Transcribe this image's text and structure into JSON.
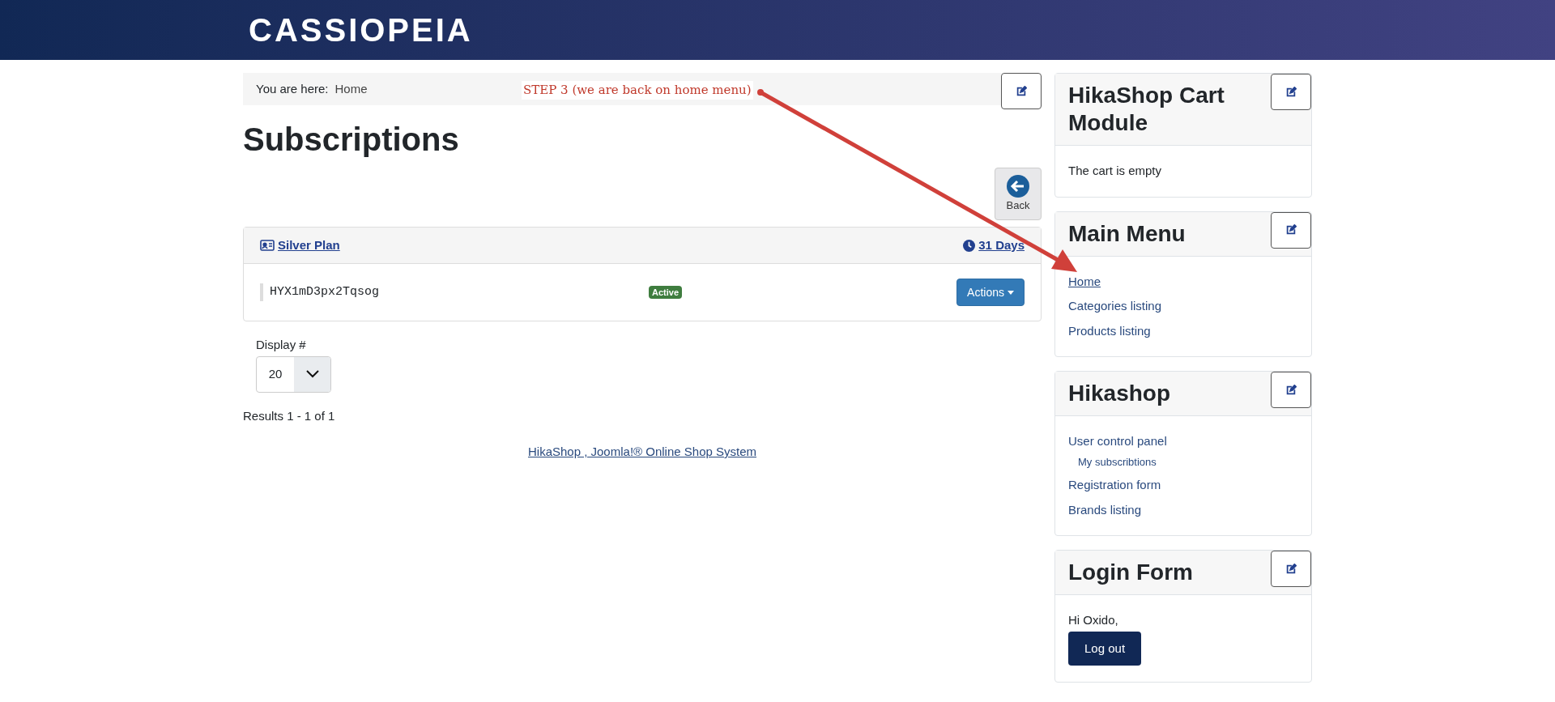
{
  "header": {
    "logo": "CASSIOPEIA"
  },
  "breadcrumb": {
    "label": "You are here:",
    "current": "Home"
  },
  "annotation": {
    "text": "STEP 3 (we are back on home menu)"
  },
  "page_title": "Subscriptions",
  "back_button": "Back",
  "subscription": {
    "plan": "Silver Plan",
    "duration": "31 Days",
    "code": "HYX1mD3px2Tqsog",
    "status": "Active",
    "actions": "Actions"
  },
  "display": {
    "label": "Display #",
    "value": "20"
  },
  "results": "Results 1 - 1 of 1",
  "footer_link": "HikaShop , Joomla!® Online Shop System",
  "sidebar": [
    {
      "kind": "text",
      "title": "HikaShop Cart Module",
      "text": "The cart is empty"
    },
    {
      "kind": "menu",
      "title": "Main Menu",
      "items": [
        {
          "label": "Home",
          "selected": true
        },
        {
          "label": "Categories listing",
          "selected": false
        },
        {
          "label": "Products listing",
          "selected": false
        }
      ]
    },
    {
      "kind": "menu",
      "title": "Hikashop",
      "items": [
        {
          "label": "User control panel",
          "selected": false,
          "children": [
            {
              "label": "My subscribtions",
              "selected": false
            }
          ]
        },
        {
          "label": "Registration form",
          "selected": false
        },
        {
          "label": "Brands listing",
          "selected": false
        }
      ]
    },
    {
      "kind": "login",
      "title": "Login Form",
      "text": "Hi Oxido,",
      "button": "Log out"
    }
  ]
}
